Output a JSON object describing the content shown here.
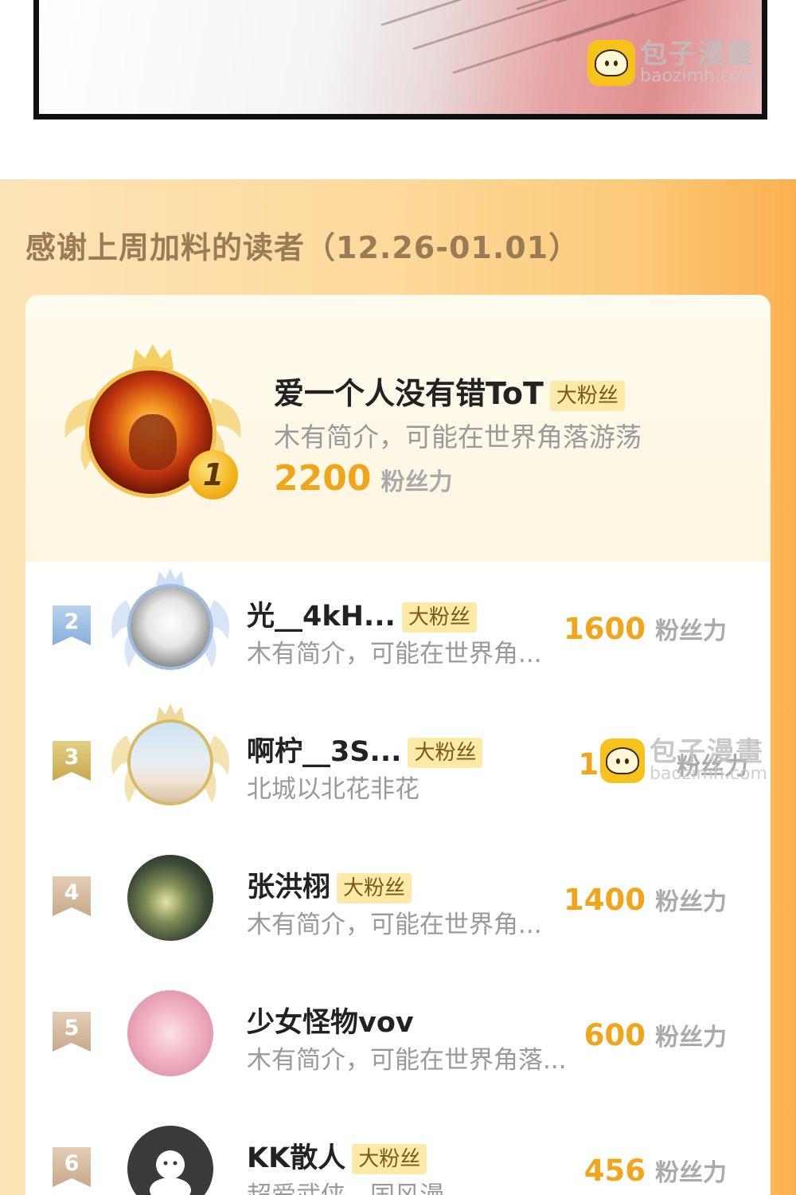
{
  "watermark": {
    "brand_cn": "包子漫畫",
    "brand_en": "baozimh.com"
  },
  "section": {
    "title": "感谢上周加料的读者（12.26-01.01）"
  },
  "power_label": "粉丝力",
  "badge_label": "大粉丝",
  "top_reader": {
    "rank": "1",
    "name": "爱一个人没有错ToT",
    "badge": "大粉丝",
    "bio": "木有简介，可能在世界角落游荡",
    "power": "2200"
  },
  "readers": [
    {
      "rank": "2",
      "name": "光__4kH...",
      "badge": "大粉丝",
      "bio": "木有简介，可能在世界角...",
      "power": "1600"
    },
    {
      "rank": "3",
      "name": "啊柠__3S...",
      "badge": "大粉丝",
      "bio": "北城以北花非花",
      "power": "16"
    },
    {
      "rank": "4",
      "name": "张洪栩",
      "badge": "大粉丝",
      "bio": "木有简介，可能在世界角...",
      "power": "1400"
    },
    {
      "rank": "5",
      "name": "少女怪物vov",
      "badge": "",
      "bio": "木有简介，可能在世界角落...",
      "power": "600"
    },
    {
      "rank": "6",
      "name": "KK散人",
      "badge": "大粉丝",
      "bio": "超爱武侠，国风漫",
      "power": "456"
    }
  ],
  "colors": {
    "accent": "#f0a51b",
    "section_bg": "#fdd99a",
    "badge_bg": "#fde9a8"
  }
}
